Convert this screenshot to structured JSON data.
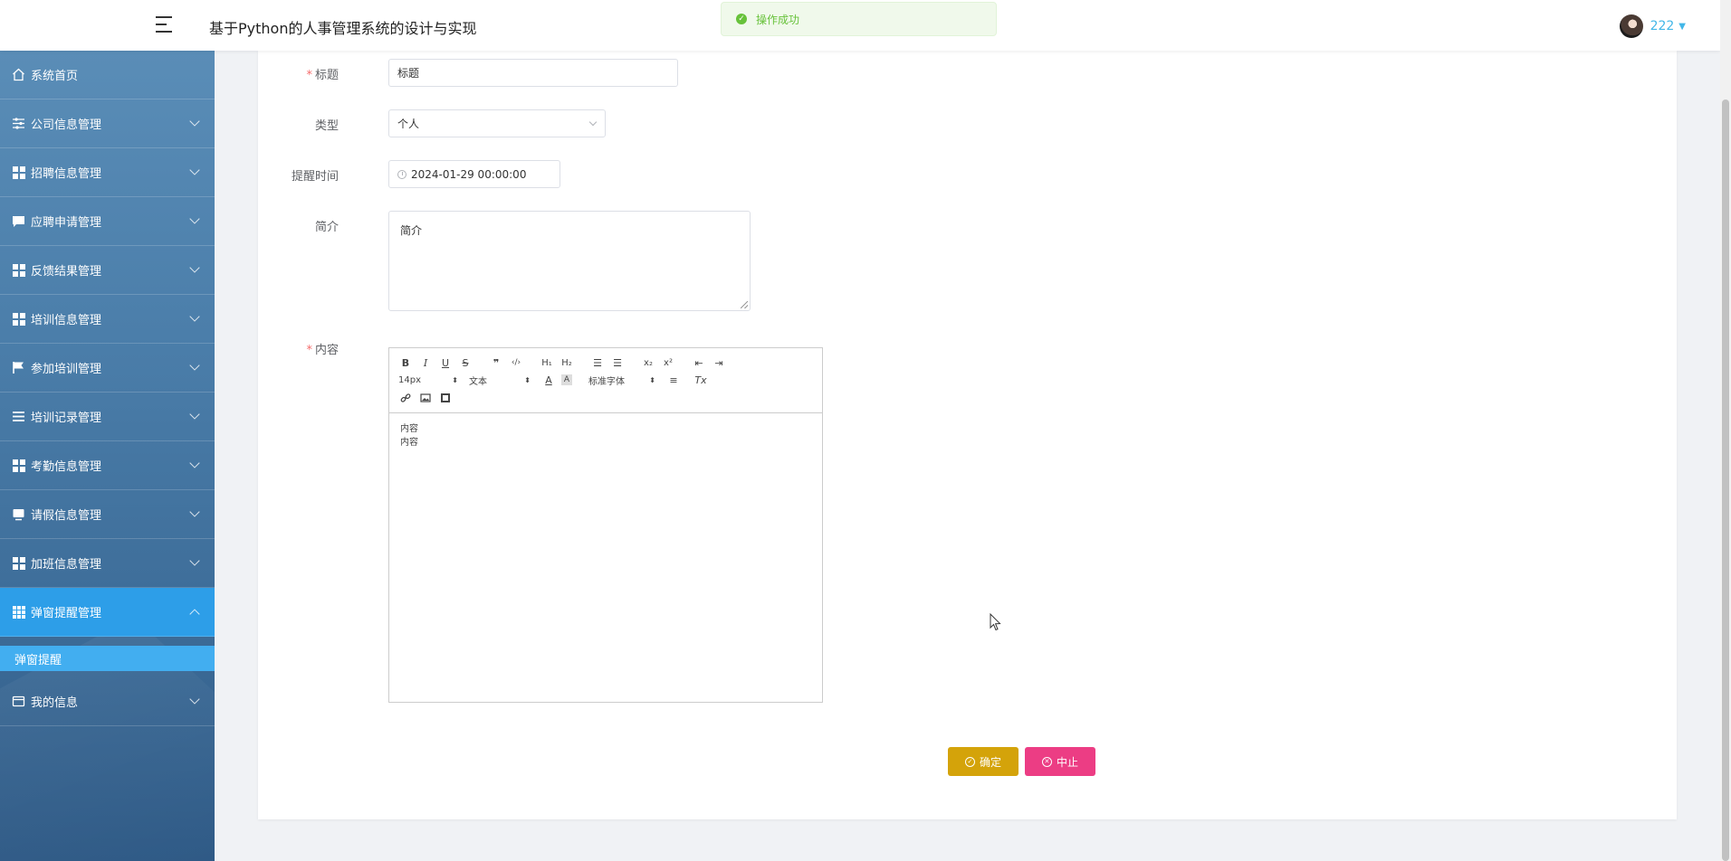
{
  "header": {
    "title": "基于Python的人事管理系统的设计与实现",
    "toast": "操作成功",
    "user": "222"
  },
  "sidebar": {
    "items": [
      {
        "label": "系统首页",
        "icon": "home-icon"
      },
      {
        "label": "公司信息管理",
        "icon": "sliders-icon"
      },
      {
        "label": "招聘信息管理",
        "icon": "grid-icon"
      },
      {
        "label": "应聘申请管理",
        "icon": "chat-icon"
      },
      {
        "label": "反馈结果管理",
        "icon": "grid-icon"
      },
      {
        "label": "培训信息管理",
        "icon": "grid-icon"
      },
      {
        "label": "参加培训管理",
        "icon": "flag-icon"
      },
      {
        "label": "培训记录管理",
        "icon": "list-icon"
      },
      {
        "label": "考勤信息管理",
        "icon": "grid-icon"
      },
      {
        "label": "请假信息管理",
        "icon": "monitor-icon"
      },
      {
        "label": "加班信息管理",
        "icon": "grid-icon"
      },
      {
        "label": "弹窗提醒管理",
        "icon": "grid9-icon"
      },
      {
        "label": "我的信息",
        "icon": "card-icon"
      }
    ],
    "subitem": "弹窗提醒"
  },
  "form": {
    "title_label": "标题",
    "title_value": "标题",
    "type_label": "类型",
    "type_value": "个人",
    "time_label": "提醒时间",
    "time_value": "2024-01-29 00:00:00",
    "intro_label": "简介",
    "intro_value": "简介",
    "content_label": "内容",
    "editor": {
      "size": "14px",
      "heading": "文本",
      "font": "标准字体",
      "lines": [
        "内容",
        "内容"
      ]
    },
    "confirm": "确定",
    "cancel": "中止"
  },
  "colors": {
    "confirm": "#d4a30a",
    "cancel": "#ec3d84",
    "accent": "#2d9ee8"
  }
}
